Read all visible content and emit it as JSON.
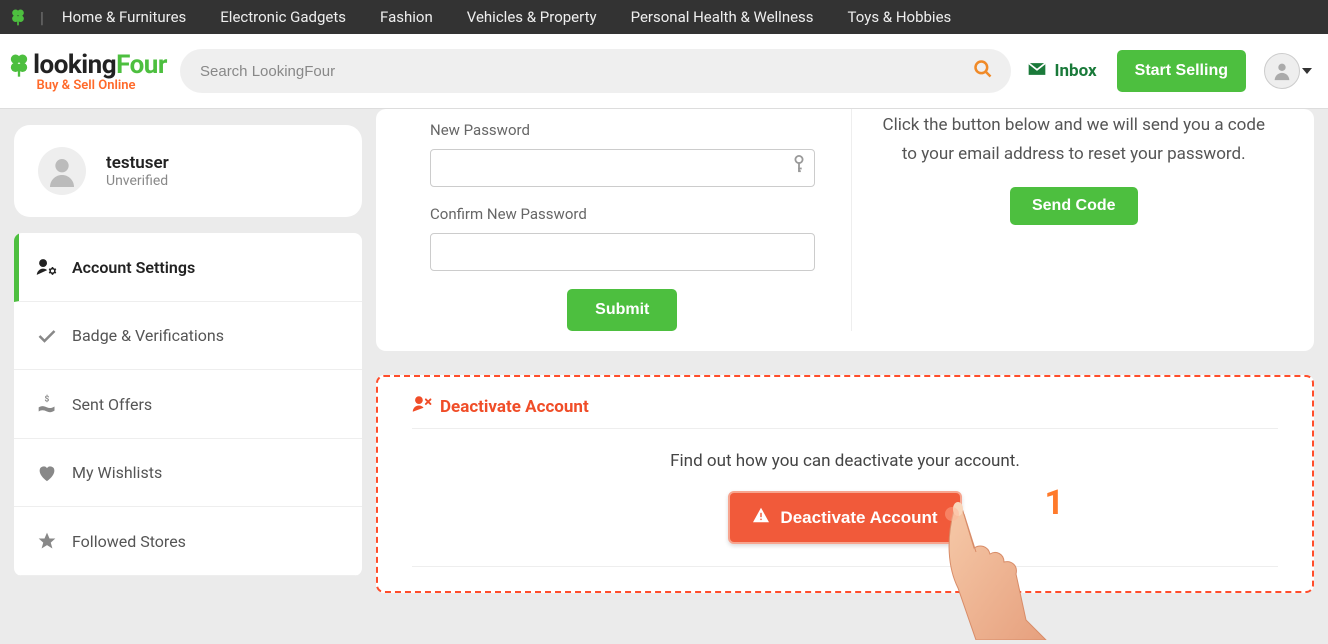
{
  "topnav": {
    "items": [
      "Home & Furnitures",
      "Electronic Gadgets",
      "Fashion",
      "Vehicles & Property",
      "Personal Health & Wellness",
      "Toys & Hobbies"
    ]
  },
  "brand": {
    "looking": "looking",
    "four": "Four",
    "tagline": "Buy & Sell Online"
  },
  "search": {
    "placeholder": "Search LookingFour"
  },
  "header": {
    "inbox": "Inbox",
    "start_selling": "Start Selling"
  },
  "user": {
    "name": "testuser",
    "status": "Unverified"
  },
  "sidemenu": {
    "items": [
      {
        "label": "Account Settings",
        "icon": "user-gear",
        "active": true
      },
      {
        "label": "Badge & Verifications",
        "icon": "check",
        "active": false
      },
      {
        "label": "Sent Offers",
        "icon": "hand-dollar",
        "active": false
      },
      {
        "label": "My Wishlists",
        "icon": "heart",
        "active": false
      },
      {
        "label": "Followed Stores",
        "icon": "star",
        "active": false
      }
    ]
  },
  "password": {
    "new_label": "New Password",
    "confirm_label": "Confirm New Password",
    "submit": "Submit",
    "reset_msg": "Click the button below and we will send you a code to your email address to reset your password.",
    "send_code": "Send Code"
  },
  "deactivate": {
    "title": "Deactivate Account",
    "desc": "Find out how you can deactivate your account.",
    "button": "Deactivate Account"
  },
  "annotation": {
    "step": "1"
  }
}
